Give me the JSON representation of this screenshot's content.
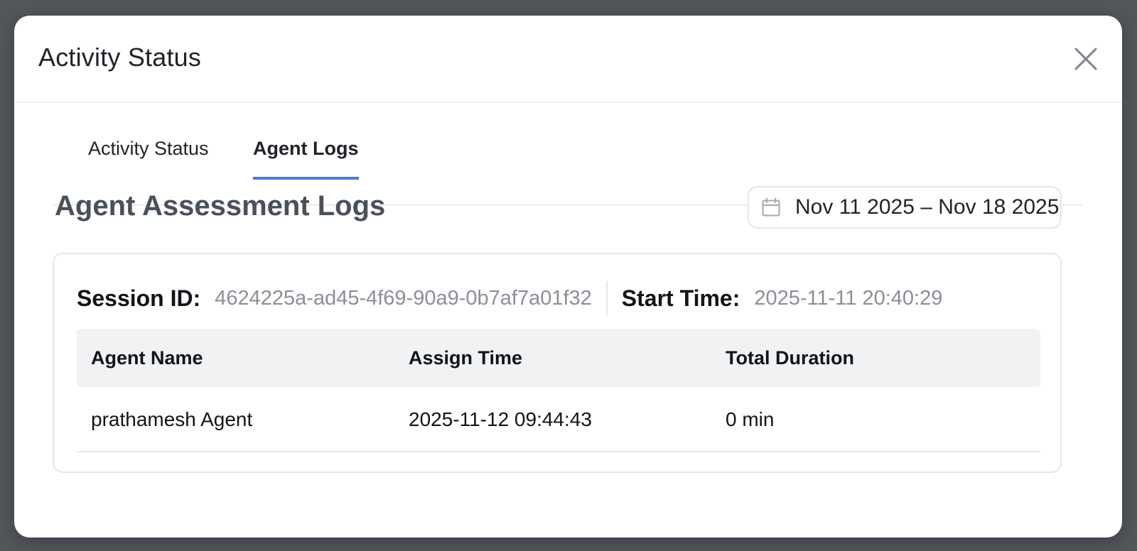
{
  "modal": {
    "title": "Activity Status"
  },
  "tabs": [
    {
      "label": "Activity Status",
      "active": false
    },
    {
      "label": "Agent Logs",
      "active": true
    }
  ],
  "section": {
    "title": "Agent Assessment Logs",
    "date_range": "Nov 11 2025 – Nov 18 2025"
  },
  "session": {
    "id_label": "Session ID:",
    "id_value": "4624225a-ad45-4f69-90a9-0b7af7a01f32",
    "start_label": "Start Time:",
    "start_value": "2025-11-11 20:40:29"
  },
  "table": {
    "columns": [
      "Agent Name",
      "Assign Time",
      "Total Duration"
    ],
    "rows": [
      [
        "prathamesh Agent",
        "2025-11-12 09:44:43",
        "0 min"
      ]
    ]
  },
  "colors": {
    "accent": "#4a7bd1",
    "backdrop": "#53565b",
    "header_bg": "#f1f2f4"
  },
  "icons": {
    "close": "close-icon",
    "calendar": "calendar-icon"
  }
}
